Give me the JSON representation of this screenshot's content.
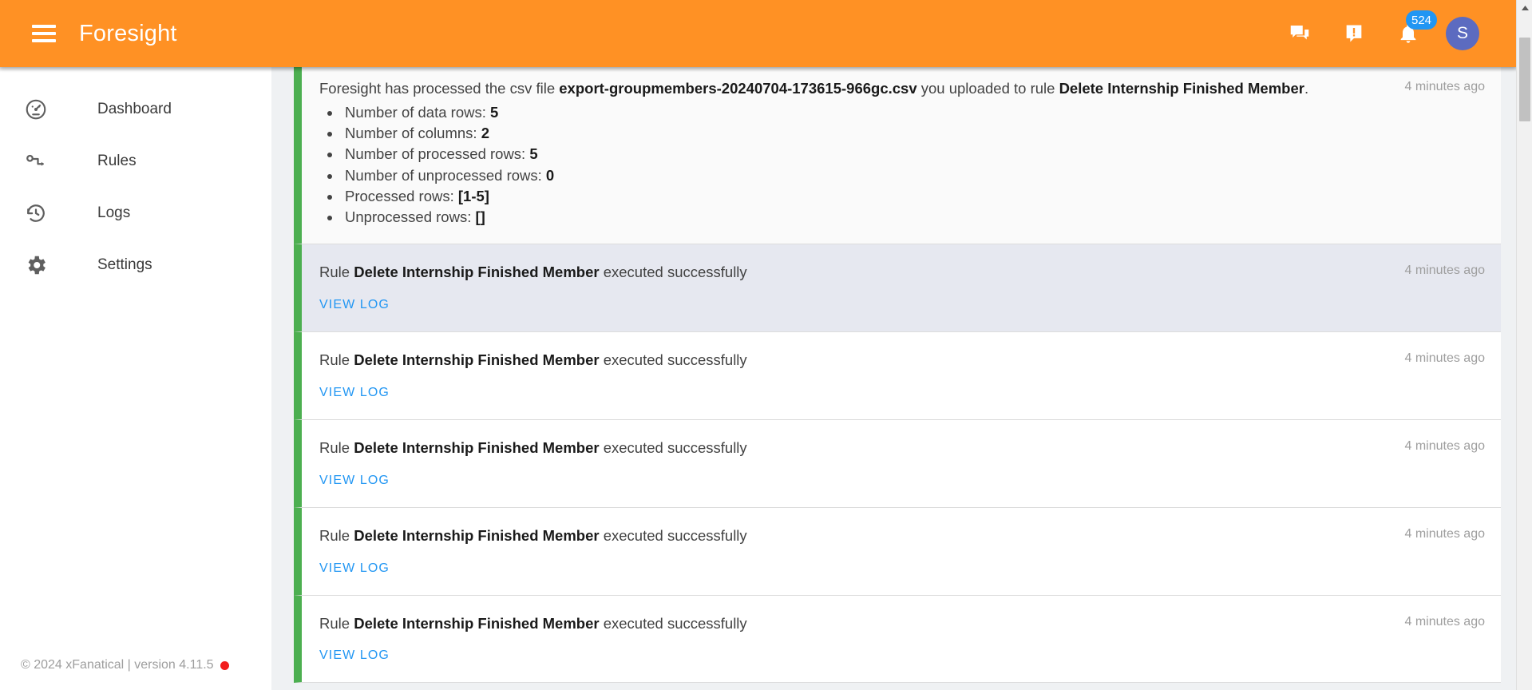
{
  "header": {
    "title": "Foresight",
    "menu_icon": "hamburger-menu-icon",
    "actions": {
      "chat_icon": "chat-bubbles-icon",
      "feedback_icon": "announcement-exclamation-icon",
      "notifications_icon": "bell-icon",
      "notification_count": "524",
      "avatar_initial": "S"
    },
    "background_color": "#FF9124",
    "badge_color": "#2196F3",
    "avatar_color": "#5C6BC0"
  },
  "sidebar": {
    "items": [
      {
        "label": "Dashboard",
        "icon": "speedometer-icon"
      },
      {
        "label": "Rules",
        "icon": "key-flow-icon"
      },
      {
        "label": "Logs",
        "icon": "history-clock-icon"
      },
      {
        "label": "Settings",
        "icon": "gear-icon"
      }
    ],
    "footer": {
      "text": "© 2024 xFanatical | version 4.11.5",
      "status_dot_color": "#F21D1D"
    }
  },
  "feed": {
    "accent_color": "#4CAF50",
    "view_log_label": "VIEW LOG",
    "cards": [
      {
        "type": "csv-processed",
        "text_prefix": "Foresight has processed the csv file ",
        "filename": "export-groupmembers-20240704-173615-966gc.csv",
        "text_middle": " you uploaded to rule ",
        "rule_name": "Delete Internship Finished Member",
        "text_suffix": ".",
        "bullets": [
          {
            "label": "Number of data rows: ",
            "value": "5"
          },
          {
            "label": "Number of columns: ",
            "value": "2"
          },
          {
            "label": "Number of processed rows: ",
            "value": "5"
          },
          {
            "label": "Number of unprocessed rows: ",
            "value": "0"
          },
          {
            "label": "Processed rows: ",
            "value": "[1-5]"
          },
          {
            "label": "Unprocessed rows: ",
            "value": "[]"
          }
        ],
        "timestamp": "4 minutes ago"
      },
      {
        "type": "rule-executed",
        "text_prefix": "Rule ",
        "rule_name": "Delete Internship Finished Member",
        "text_suffix": " executed successfully",
        "timestamp": "4 minutes ago",
        "highlighted": true
      },
      {
        "type": "rule-executed",
        "text_prefix": "Rule ",
        "rule_name": "Delete Internship Finished Member",
        "text_suffix": " executed successfully",
        "timestamp": "4 minutes ago",
        "highlighted": false
      },
      {
        "type": "rule-executed",
        "text_prefix": "Rule ",
        "rule_name": "Delete Internship Finished Member",
        "text_suffix": " executed successfully",
        "timestamp": "4 minutes ago",
        "highlighted": false
      },
      {
        "type": "rule-executed",
        "text_prefix": "Rule ",
        "rule_name": "Delete Internship Finished Member",
        "text_suffix": " executed successfully",
        "timestamp": "4 minutes ago",
        "highlighted": false
      },
      {
        "type": "rule-executed",
        "text_prefix": "Rule ",
        "rule_name": "Delete Internship Finished Member",
        "text_suffix": " executed successfully",
        "timestamp": "4 minutes ago",
        "highlighted": false
      }
    ]
  }
}
